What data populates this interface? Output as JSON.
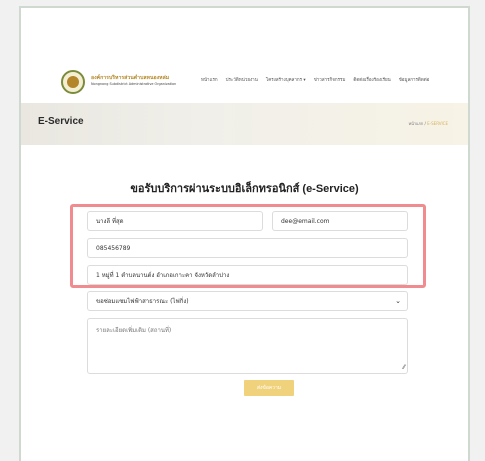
{
  "header": {
    "org_name": "องค์การบริหารส่วนตำบลหนองหล่ม",
    "org_sub": "Nongnong Subdistrict Administrative Organization",
    "nav": [
      "หน้าแรก",
      "ประวัติหน่วยงาน",
      "โครงสร้างบุคลากร ▾",
      "ข่าวสารกิจกรรม",
      "ติดต่อเรื่องร้องเรียน",
      "ข้อมูลการติดต่อ"
    ]
  },
  "banner": {
    "title": "E-Service",
    "breadcrumb_home": "หน้าแรก",
    "breadcrumb_sep": " / ",
    "breadcrumb_current": "E-SERVICE"
  },
  "form": {
    "title": "ขอรับบริการผ่านระบบอิเล็กทรอนิกส์ (e-Service)",
    "name_value": "นางลี  ที่สุด",
    "email_value": "dee@email.com",
    "phone_value": "085456789",
    "address_value": "1 หมู่ที่ 1 ตำบลนานต์ง อำเภอเกาะคา จังหวัดลำปาง",
    "service_value": "ขอซ่อมแซมไฟฟ้าสาธารณะ (ไฟกิ่ง)",
    "details_placeholder": "รายละเอียดเพิ่มเติม (สถานที่)",
    "submit_label": "ส่งข้อความ"
  },
  "colors": {
    "highlight": "#f08c8f",
    "accent": "#f1d27c"
  }
}
